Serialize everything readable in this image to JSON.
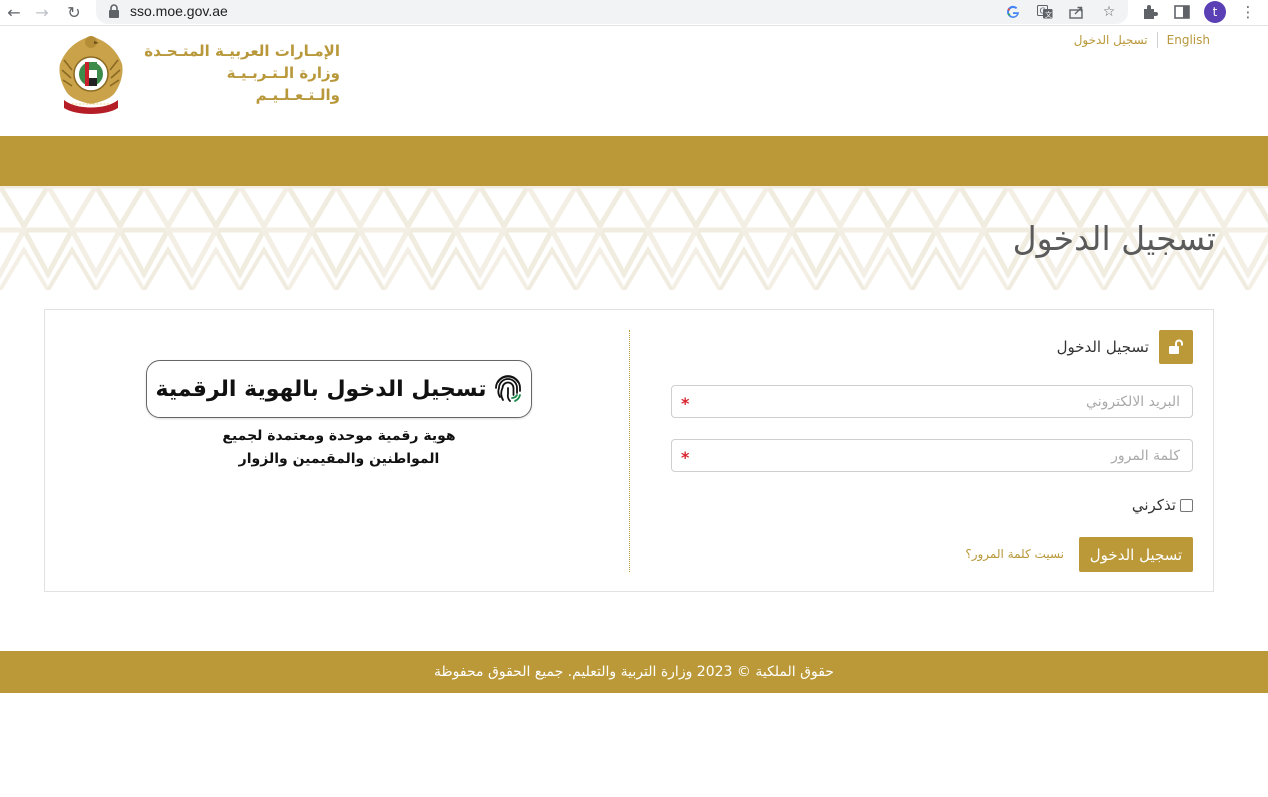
{
  "browser": {
    "url": "sso.moe.gov.ae",
    "profile_initial": "t"
  },
  "header": {
    "logo_line1": "الإمـارات العربيـة المتـحـدة",
    "logo_line2": "وزارة الـتـربـيـة والـتـعـلـيـم",
    "top_links": {
      "english": "English",
      "login": "تسجيل الدخول"
    }
  },
  "page": {
    "title": "تسجيل الدخول"
  },
  "login_form": {
    "header_title": "تسجيل الدخول",
    "email_placeholder": "البريد الالكتروني",
    "password_placeholder": "كلمة المرور",
    "required_mark": "*",
    "remember_label": "تذكرني",
    "remember_checked": false,
    "submit_label": "تسجيل الدخول",
    "forgot_label": "نسيت كلمة المرور؟"
  },
  "uae_pass": {
    "button_label": "تسجيل الدخول بالهوية الرقمية",
    "desc_line1": "هوية رقمية موحدة ومعتمدة لجميع",
    "desc_line2": "المواطنين والمقيمين والزوار"
  },
  "footer": {
    "copyright": "حقوق الملكية © 2023 وزارة التربية والتعليم. جميع الحقوق محفوظة"
  },
  "colors": {
    "gold": "#bb9938",
    "gold_text": "#b8983a",
    "required": "#d9232e"
  }
}
